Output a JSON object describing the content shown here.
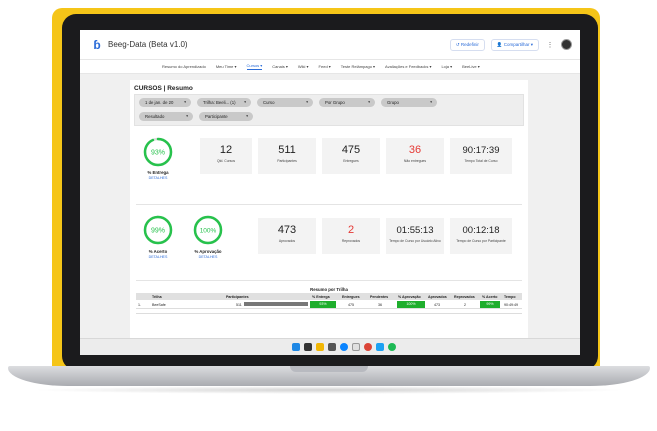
{
  "app": {
    "title": "Beeg-Data (Beta v1.0)",
    "share_label": "Compartilhar",
    "reset_label": "Redefinir"
  },
  "nav": {
    "items": [
      "Resumo do Aprendizado",
      "Meu Time ▾",
      "Cursos ▾",
      "Canais ▾",
      "Wiki ▾",
      "Feed ▾",
      "Teste Relâmpago ▾",
      "Avaliações e Feedbacks ▾",
      "Loja ▾",
      "BeeLive ▾"
    ],
    "active_index": 2
  },
  "report": {
    "title": "CURSOS | Resumo",
    "filters": [
      {
        "label": "1 de jan. de 20",
        "caret": "▾"
      },
      {
        "label": "Trilha: Beeli... (1)",
        "caret": "▾"
      },
      {
        "label": "Curso",
        "caret": "▾"
      },
      {
        "label": "Por Grupo",
        "caret": "▾"
      },
      {
        "label": "Grupo",
        "caret": "▾"
      },
      {
        "label": "Resultado",
        "caret": "▾"
      },
      {
        "label": "Participante",
        "caret": "▾"
      }
    ]
  },
  "kpis_row1": {
    "gauge": {
      "value": "93%",
      "fraction": 0.93,
      "label": "% Entrega",
      "link": "DETALHES"
    },
    "cards": [
      {
        "value": "12",
        "label": "Qtd. Cursos"
      },
      {
        "value": "511",
        "label": "Participantes"
      },
      {
        "value": "475",
        "label": "Entregues"
      },
      {
        "value": "36",
        "label": "Não entregues"
      },
      {
        "value": "90:17:39",
        "label": "Tempo Total de Curso"
      }
    ]
  },
  "kpis_row2": {
    "gauges": [
      {
        "value": "99%",
        "fraction": 0.99,
        "label": "% Acerto",
        "link": "DETALHES"
      },
      {
        "value": "100%",
        "fraction": 1.0,
        "label": "% Aprovação",
        "link": "DETALHES"
      }
    ],
    "cards": [
      {
        "value": "473",
        "label": "Aprovados"
      },
      {
        "value": "2",
        "label": "Reprovados"
      },
      {
        "value": "01:55:13",
        "label": "Tempo de Curso por Usuário Ativo"
      },
      {
        "value": "00:12:18",
        "label": "Tempo de Curso por Participante"
      }
    ]
  },
  "table": {
    "title": "Resumo por Trilha",
    "headers": [
      "Trilha",
      "Participantes",
      "% Entrega",
      "Entregues",
      "Pendentes",
      "% Aprovação",
      "Aprovados",
      "Reprovados",
      "% Acerto",
      "Tempo"
    ],
    "rows": [
      {
        "index": "1.",
        "trilha": "BeeSafe",
        "participantes": "511",
        "entrega": "93%",
        "entregues": "475",
        "pendentes": "36",
        "aprovacao": "100%",
        "aprovados": "473",
        "reprovados": "2",
        "acerto": "99%",
        "tempo": "90:49:49"
      }
    ]
  },
  "colors": {
    "accent": "#2b6cd8",
    "gauge_green": "#27c24c",
    "alert_red": "#e53935",
    "cell_green": "#1fae2d",
    "laptop_yellow": "#f5c518"
  }
}
